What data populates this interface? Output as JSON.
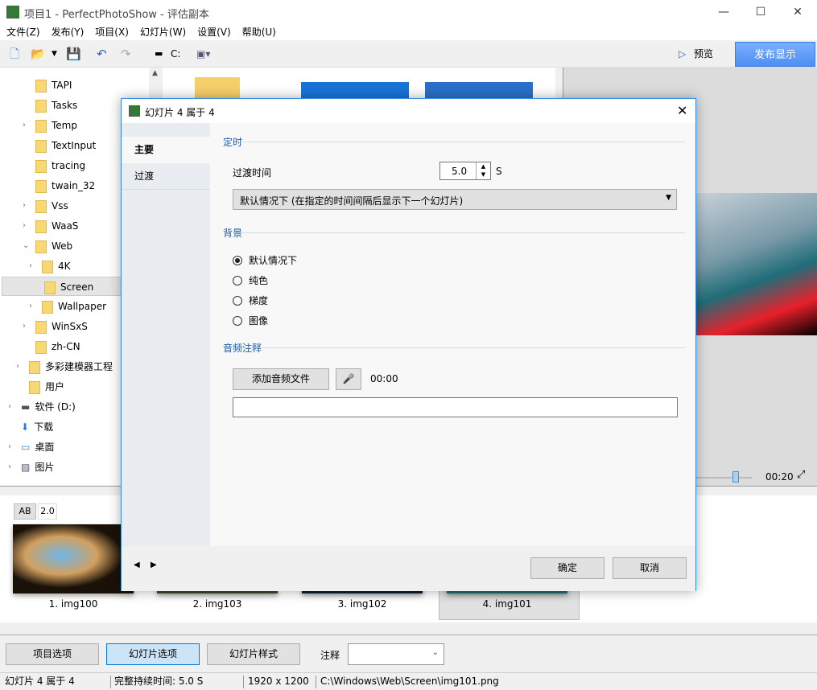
{
  "window": {
    "title": "项目1 - PerfectPhotoShow - 评估副本",
    "min": "—",
    "max": "☐",
    "close": "✕"
  },
  "menu": [
    "文件(Z)",
    "发布(Y)",
    "项目(X)",
    "幻灯片(W)",
    "设置(V)",
    "帮助(U)"
  ],
  "toolbar": {
    "drive": "C:",
    "preview": "预览",
    "publish": "发布显示"
  },
  "tree": [
    {
      "label": "TAPI",
      "level": 1,
      "arrow": ""
    },
    {
      "label": "Tasks",
      "level": 1,
      "arrow": ""
    },
    {
      "label": "Temp",
      "level": 1,
      "arrow": "›"
    },
    {
      "label": "TextInput",
      "level": 1,
      "arrow": ""
    },
    {
      "label": "tracing",
      "level": 1,
      "arrow": ""
    },
    {
      "label": "twain_32",
      "level": 1,
      "arrow": ""
    },
    {
      "label": "Vss",
      "level": 1,
      "arrow": "›"
    },
    {
      "label": "WaaS",
      "level": 1,
      "arrow": "›"
    },
    {
      "label": "Web",
      "level": 1,
      "arrow": "⌄"
    },
    {
      "label": "4K",
      "level": 2,
      "arrow": "›"
    },
    {
      "label": "Screen",
      "level": 2,
      "arrow": "",
      "selected": true
    },
    {
      "label": "Wallpaper",
      "level": 2,
      "arrow": "›"
    },
    {
      "label": "WinSxS",
      "level": 1,
      "arrow": "›"
    },
    {
      "label": "zh-CN",
      "level": 1,
      "arrow": ""
    },
    {
      "label": "多彩建模器工程",
      "level": 0,
      "arrow": "›"
    },
    {
      "label": "用户",
      "level": 0,
      "arrow": ""
    },
    {
      "label": "软件 (D:)",
      "level": 0,
      "arrow": "›",
      "icon": "drive"
    },
    {
      "label": "下载",
      "level": 0,
      "arrow": "",
      "icon": "download"
    },
    {
      "label": "桌面",
      "level": 0,
      "arrow": "›",
      "icon": "desktop"
    },
    {
      "label": "图片",
      "level": 0,
      "arrow": "›",
      "icon": "pictures"
    }
  ],
  "player": {
    "time": "00:20"
  },
  "strip": {
    "ab": "AB",
    "version": "2.0",
    "slides": [
      "1. img100",
      "2. img103",
      "3. img102",
      "4. img101"
    ]
  },
  "bottom": {
    "project_options": "项目选项",
    "slide_options": "幻灯片选项",
    "slide_style": "幻灯片样式",
    "note_label": "注释",
    "note_value": ""
  },
  "status": {
    "slide": "幻灯片 4 属于 4",
    "duration": "完整持续时间: 5.0 S",
    "resolution": "1920 x 1200",
    "path": "C:\\Windows\\Web\\Screen\\img101.png"
  },
  "dialog": {
    "title": "幻灯片 4 属于 4",
    "tabs": [
      "主要",
      "过渡"
    ],
    "timing": {
      "section": "定时",
      "label": "过渡时间",
      "value": "5.0",
      "unit": "S",
      "mode": "默认情况下 (在指定的时间间隔后显示下一个幻灯片)"
    },
    "background": {
      "section": "背景",
      "options": [
        "默认情况下",
        "纯色",
        "梯度",
        "图像"
      ],
      "selected": 0
    },
    "audio": {
      "section": "音频注释",
      "add": "添加音频文件",
      "time": "00:00",
      "path": ""
    },
    "ok": "确定",
    "cancel": "取消"
  },
  "colors": {
    "accent": "#3a8ee6",
    "publish": "#5a98f5"
  }
}
